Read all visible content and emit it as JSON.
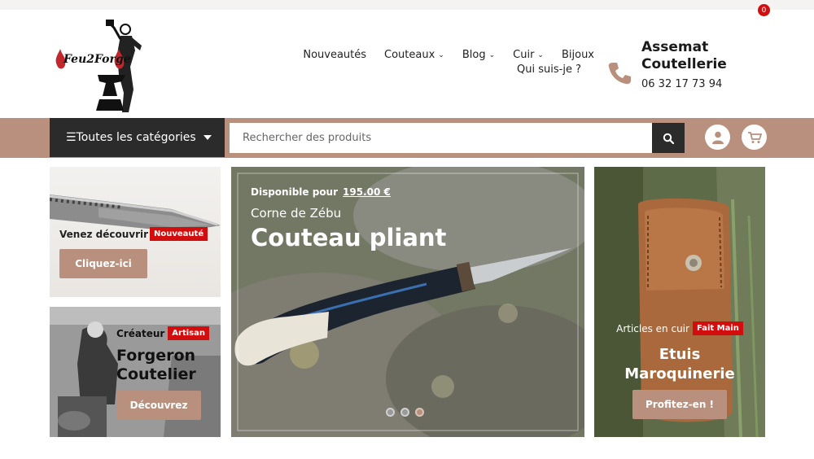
{
  "brand": {
    "logo_text": "FEU2FORGE"
  },
  "nav": {
    "items": [
      {
        "label": "Nouveautés",
        "dropdown": false
      },
      {
        "label": "Couteaux",
        "dropdown": true
      },
      {
        "label": "Blog",
        "dropdown": true
      },
      {
        "label": "Cuir",
        "dropdown": true
      },
      {
        "label": "Bijoux",
        "dropdown": false
      }
    ],
    "second_row": "Qui suis-je ?"
  },
  "contact": {
    "name": "Assemat Coutellerie",
    "phone": "06 32 17 73 94"
  },
  "bar": {
    "categories_label": "☰Toutes les catégories",
    "search_placeholder": "Rechercher des produits",
    "cart_count": "0"
  },
  "promo_left_top": {
    "text": "Venez découvrir",
    "badge": "Nouveauté",
    "button": "Cliquez-ici"
  },
  "promo_left_bottom": {
    "kicker": "Créateur",
    "badge": "Artisan",
    "title_line1": "Forgeron",
    "title_line2": "Coutelier",
    "button": "Découvrez"
  },
  "slider": {
    "available_prefix": "Disponible pour",
    "price": "195.00 €",
    "subtitle": "Corne de Zébu",
    "title": "Couteau pliant",
    "dots": 3,
    "active_dot": 3
  },
  "promo_right": {
    "kicker": "Articles en cuir",
    "badge": "Fait Main",
    "title_line1": "Etuis",
    "title_line2": "Maroquinerie",
    "button": "Profitez-en !"
  },
  "colors": {
    "accent": "#b8907d",
    "dark": "#2b2b2b",
    "badge_red": "#d10d0d"
  }
}
